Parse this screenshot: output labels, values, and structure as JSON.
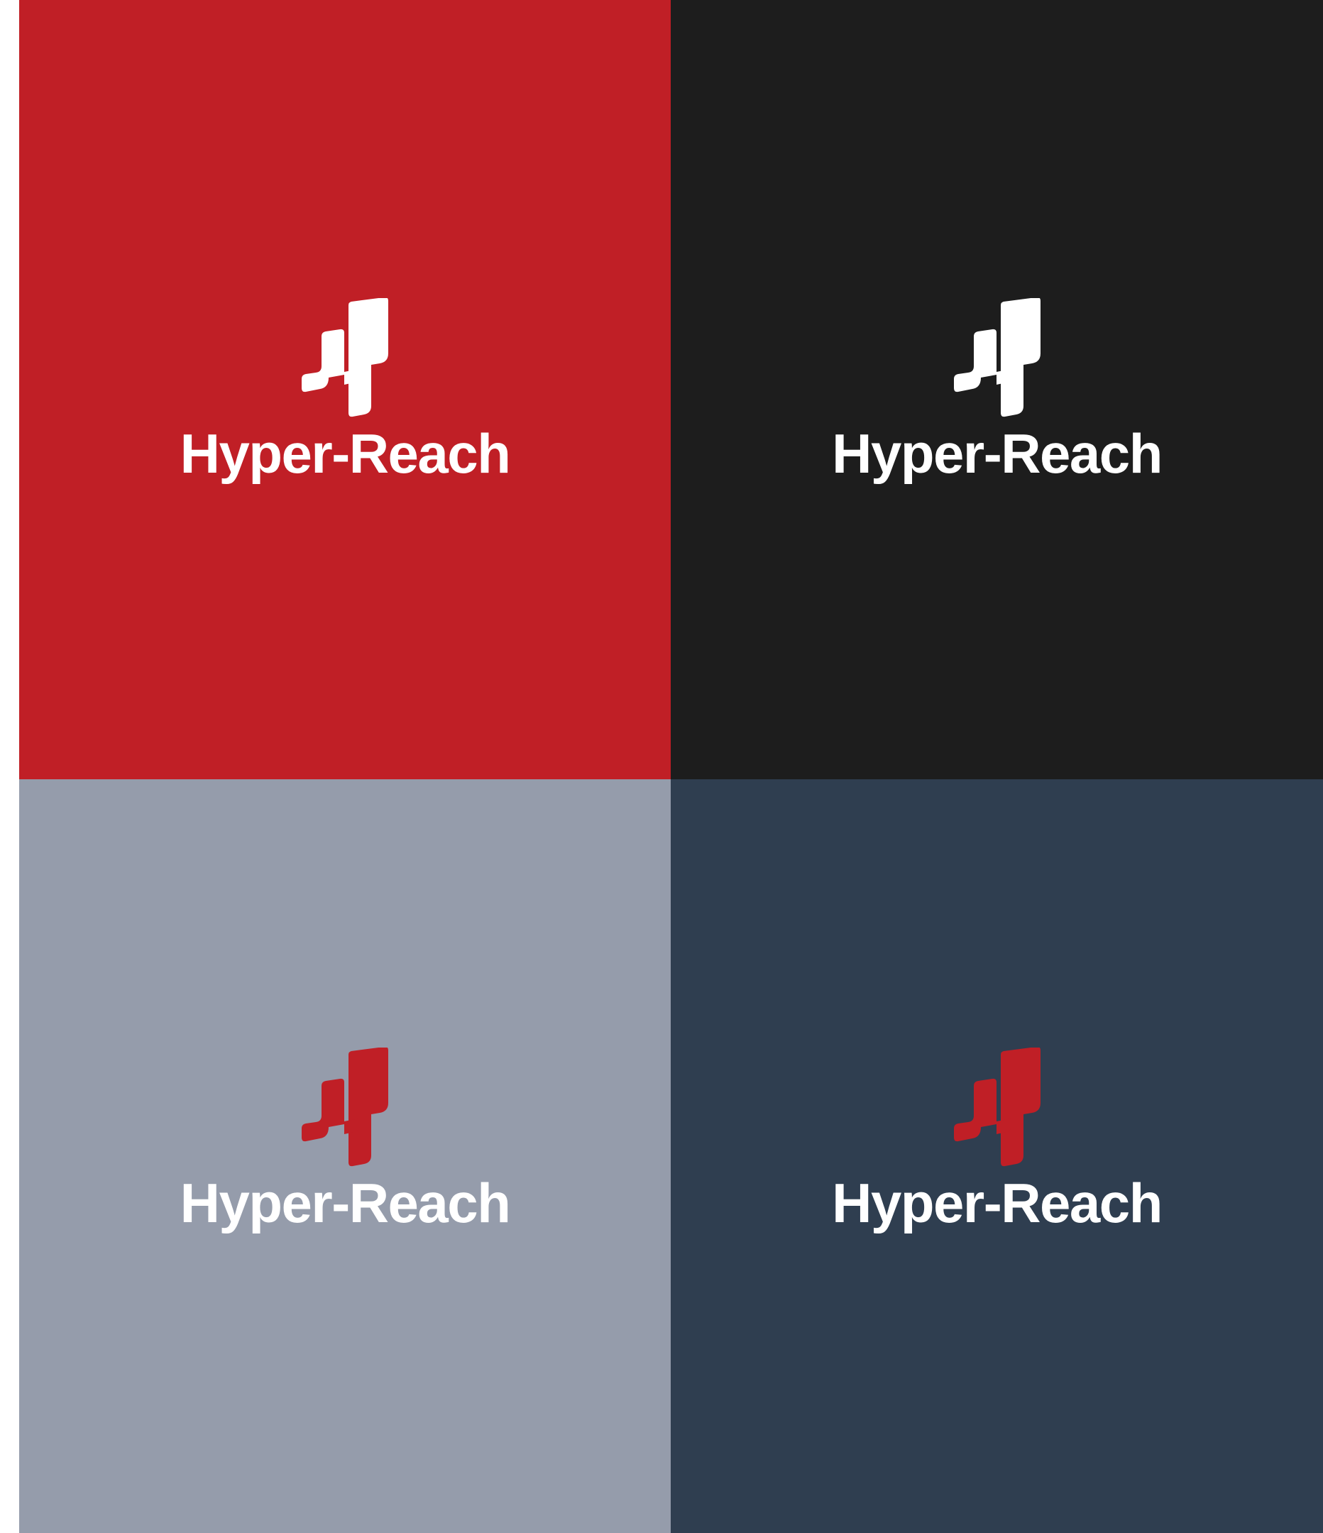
{
  "panels": [
    {
      "id": "red",
      "background": "#c01f26",
      "mark_color": "#ffffff",
      "text_color": "#ffffff",
      "brand": "Hyper-Reach"
    },
    {
      "id": "black",
      "background": "#1d1d1d",
      "mark_color": "#ffffff",
      "text_color": "#ffffff",
      "brand": "Hyper-Reach"
    },
    {
      "id": "gray",
      "background": "#959cab",
      "mark_color": "#c01f26",
      "text_color": "#ffffff",
      "brand": "Hyper-Reach"
    },
    {
      "id": "navy",
      "background": "#2f3e50",
      "mark_color": "#c01f26",
      "text_color": "#ffffff",
      "brand": "Hyper-Reach"
    }
  ]
}
